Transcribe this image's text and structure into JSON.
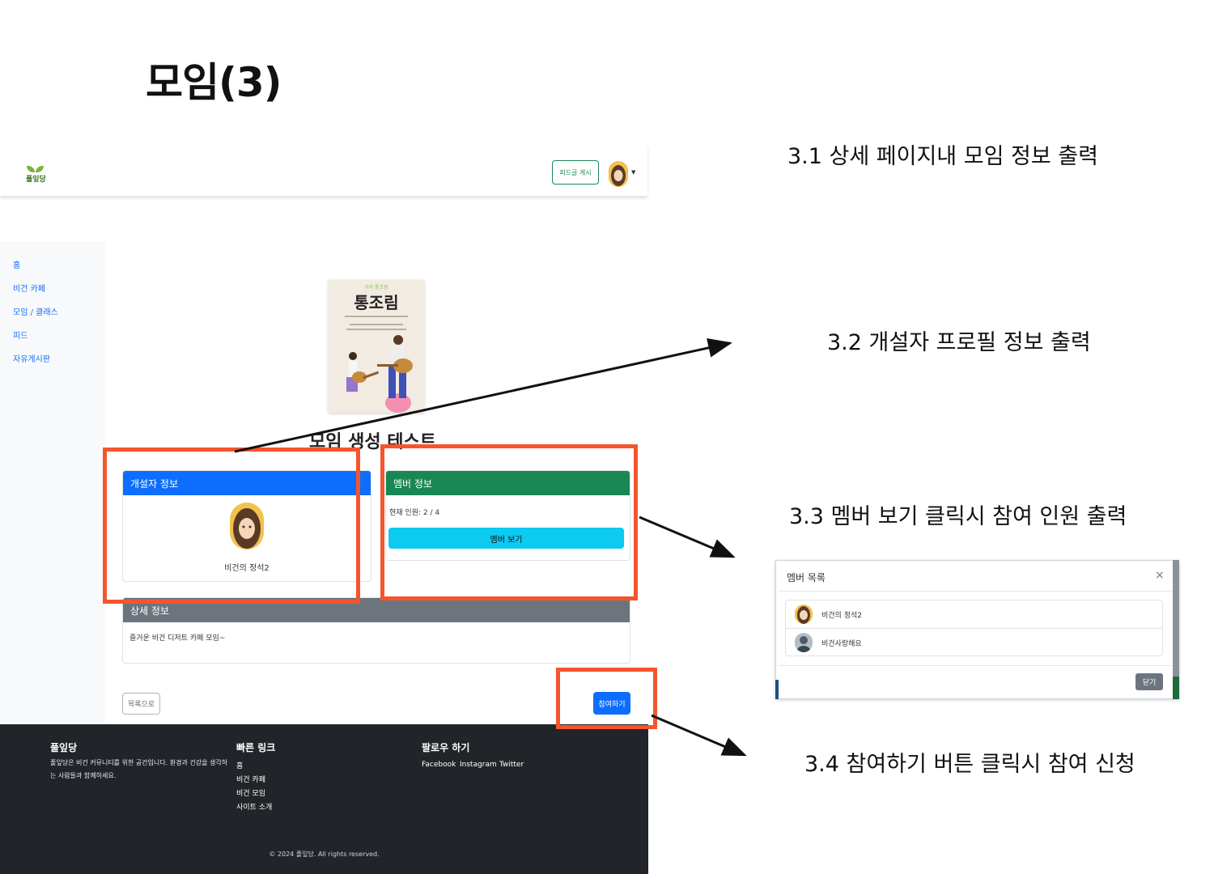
{
  "slide": {
    "title": "모임(3)"
  },
  "app": {
    "logo_text": "풀잎당",
    "feed_button": "피드글 게시",
    "sidebar": [
      "홈",
      "비건 카페",
      "모임 / 클래스",
      "피드",
      "자유게시판"
    ],
    "cover": {
      "small": "가자 통조림",
      "big": "통조림"
    },
    "meeting_name": "모임 생성 테스트",
    "creator_card": {
      "header": "개설자 정보",
      "name": "비건의 정석2"
    },
    "member_card": {
      "header": "멤버 정보",
      "count": "현재 인원: 2 / 4",
      "view_button": "멤버 보기"
    },
    "detail_card": {
      "header": "상세 정보",
      "text": "즐거운 비건 디저트 카페 모임~"
    },
    "list_button": "목록으로",
    "join_button": "참여하기"
  },
  "footer": {
    "brand_title": "풀잎당",
    "brand_text_1": "풀잎당은 비건 커뮤니티를 위한 공간입니다. 환경과 건강을 생각하",
    "brand_text_2": "는 사람들과 함께하세요.",
    "links_title": "빠른 링크",
    "links": [
      "홈",
      "비건 카페",
      "비건 모임",
      "사이트 소개"
    ],
    "follow_title": "팔로우 하기",
    "social": [
      "Facebook",
      "Instagram",
      "Twitter"
    ],
    "copyright": "© 2024 풀잎당. All rights reserved."
  },
  "annotations": {
    "a1": "3.1 상세 페이지내 모임 정보 출력",
    "a2": "3.2 개설자 프로필 정보 출력",
    "a3": "3.3 멤버 보기 클릭시 참여 인원 출력",
    "a4": "3.4 참여하기 버튼 클릭시 참여 신청"
  },
  "modal": {
    "title": "멤버 목록",
    "close_icon": "×",
    "members": [
      "비건의 정석2",
      "비건사랑해요"
    ],
    "close_button": "닫기"
  },
  "colors": {
    "highlight": "#f4552d",
    "primary": "#0d6efd",
    "success": "#198754",
    "info": "#0dcaf0",
    "footer": "#212529"
  }
}
